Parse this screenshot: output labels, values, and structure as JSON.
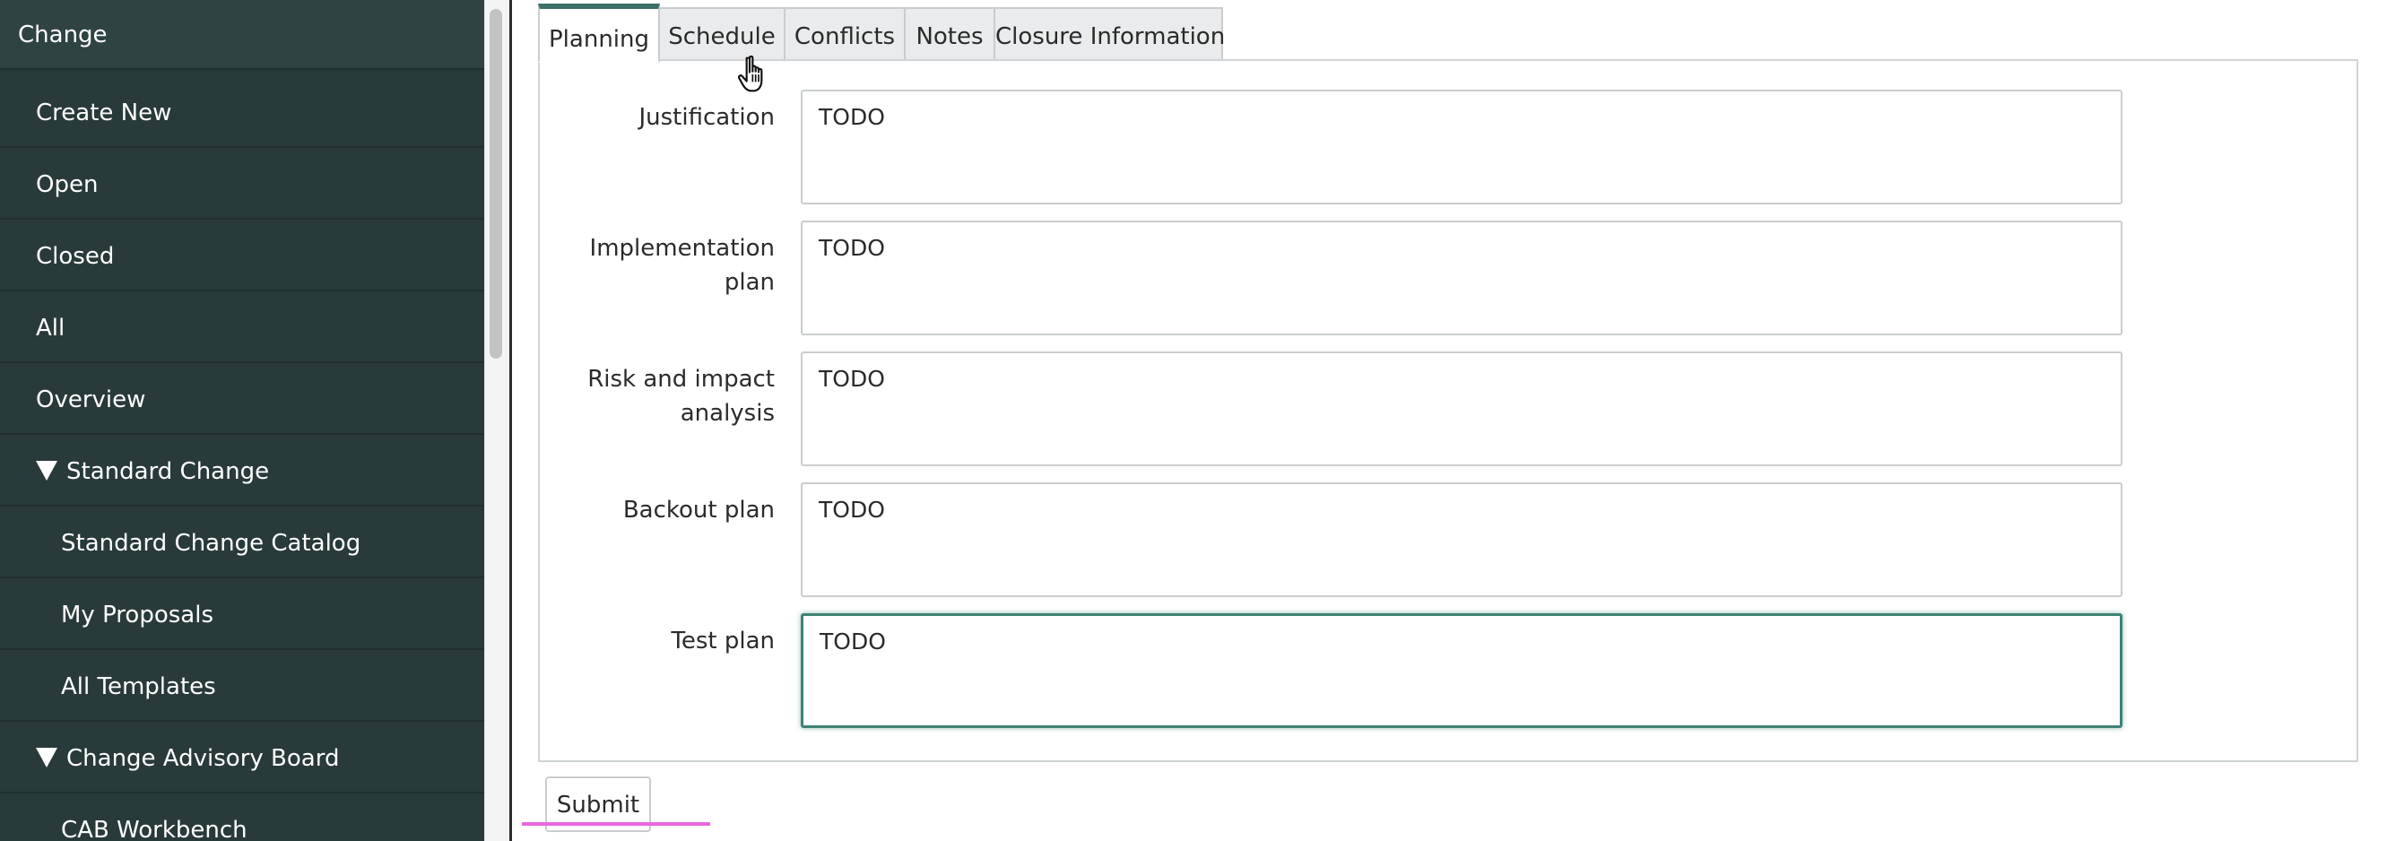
{
  "sidebar": {
    "header": "Change",
    "items": [
      {
        "label": "Create New"
      },
      {
        "label": "Open"
      },
      {
        "label": "Closed"
      },
      {
        "label": "All"
      },
      {
        "label": "Overview"
      },
      {
        "label": "Standard Change",
        "expanded": true
      },
      {
        "label": "Standard Change Catalog"
      },
      {
        "label": "My Proposals"
      },
      {
        "label": "All Templates"
      },
      {
        "label": "Change Advisory Board",
        "expanded": true
      },
      {
        "label": "CAB Workbench"
      }
    ]
  },
  "tabs": [
    {
      "label": "Planning",
      "active": true
    },
    {
      "label": "Schedule"
    },
    {
      "label": "Conflicts"
    },
    {
      "label": "Notes"
    },
    {
      "label": "Closure Information"
    }
  ],
  "form": {
    "fields": [
      {
        "label": "Justification",
        "value": "TODO"
      },
      {
        "label": "Implementation plan",
        "value": "TODO"
      },
      {
        "label": "Risk and impact analysis",
        "value": "TODO"
      },
      {
        "label": "Backout plan",
        "value": "TODO"
      },
      {
        "label": "Test plan",
        "value": "TODO",
        "focused": true
      }
    ],
    "submit_label": "Submit"
  },
  "colors": {
    "sidebar_bg": "#283a3a",
    "active_tab_accent": "#3a7068",
    "focus_border": "#3e8276",
    "annotation_underline": "#e868e0"
  }
}
